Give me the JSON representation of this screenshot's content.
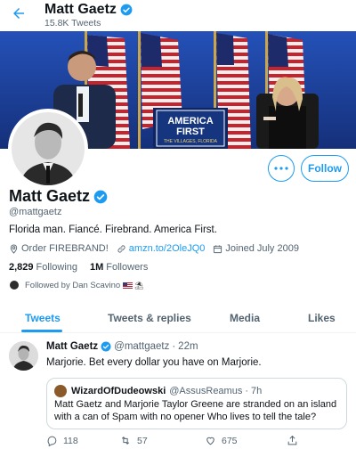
{
  "header": {
    "title": "Matt Gaetz",
    "tweet_count": "15.8K Tweets",
    "back_icon": "back-arrow-icon"
  },
  "banner": {
    "sign_line1": "AMERICA",
    "sign_line2": "FIRST",
    "sign_line3": "THE VILLAGES, FLORIDA"
  },
  "profile": {
    "name": "Matt Gaetz",
    "handle": "@mattgaetz",
    "bio": "Florida man. Fiancé. Firebrand. America First.",
    "location": "Order FIREBRAND!",
    "url": "amzn.to/2OleJQ0",
    "joined": "Joined July 2009",
    "following_count": "2,829",
    "following_label": "Following",
    "followers_count": "1M",
    "followers_label": "Followers",
    "followed_by": "Followed by Dan Scavino",
    "follow_button": "Follow",
    "verified_color": "#1d9bf0"
  },
  "tabs": [
    {
      "label": "Tweets",
      "active": true
    },
    {
      "label": "Tweets & replies",
      "active": false
    },
    {
      "label": "Media",
      "active": false
    },
    {
      "label": "Likes",
      "active": false
    }
  ],
  "tweet": {
    "name": "Matt Gaetz",
    "handle": "@mattgaetz",
    "separator": "·",
    "time": "22m",
    "text": "Marjorie. Bet every dollar you have on Marjorie.",
    "quote": {
      "name": "WizardOfDudeowski",
      "handle": "@AssusReamus",
      "separator": "·",
      "time": "7h",
      "text": "Matt Gaetz and Marjorie Taylor Greene are stranded on an island with a can of Spam with no opener Who lives to tell the tale?"
    },
    "replies": "118",
    "retweets": "57",
    "likes": "675"
  },
  "colors": {
    "accent": "#1d9bf0",
    "text": "#0f1419",
    "secondary": "#536471"
  }
}
